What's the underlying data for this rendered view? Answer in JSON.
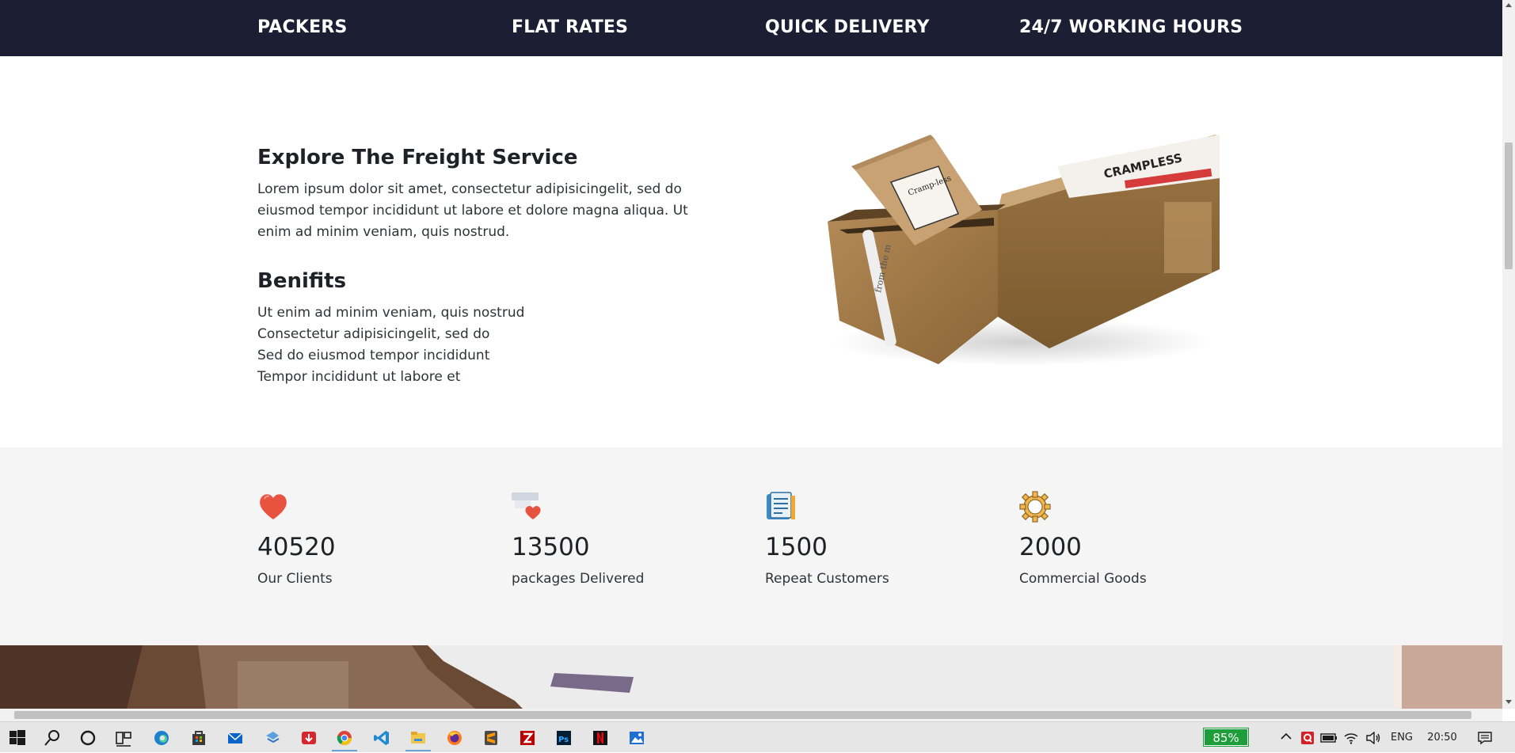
{
  "features": {
    "items": [
      "PACKERS",
      "FLAT RATES",
      "QUICK DELIVERY",
      "24/7 WORKING HOURS"
    ]
  },
  "explore": {
    "title": "Explore The Freight Service",
    "text": "Lorem ipsum dolor sit amet, consectetur adipisicingelit, sed do eiusmod tempor incididunt ut labore et dolore magna aliqua. Ut enim ad minim veniam, quis nostrud."
  },
  "benefits": {
    "title": "Benifits",
    "items": [
      "Ut enim ad minim veniam, quis nostrud",
      "Consectetur adipisicingelit, sed do",
      "Sed do eiusmod tempor incididunt",
      "Tempor incididunt ut labore et"
    ]
  },
  "product_image": {
    "label_big": "CRAMPLESS",
    "label_bag": "Cramp-less",
    "label_tab": "from the m"
  },
  "stats": [
    {
      "icon": "heart-icon",
      "number": "40520",
      "label": "Our Clients"
    },
    {
      "icon": "package-heart-icon",
      "number": "13500",
      "label": "packages Delivered"
    },
    {
      "icon": "document-list-icon",
      "number": "1500",
      "label": "Repeat Customers"
    },
    {
      "icon": "gear-icon",
      "number": "2000",
      "label": "Commercial Goods"
    }
  ],
  "colors": {
    "navbar": "#1c1f33",
    "stats_bg": "#f5f5f5",
    "heart": "#e8533f",
    "battery": "#1e9e3a"
  },
  "taskbar": {
    "apps": [
      "start-icon",
      "search-icon",
      "cortana-icon",
      "task-view-icon",
      "edge-icon",
      "store-icon",
      "mail-icon",
      "app-icon",
      "download-icon",
      "chrome-icon",
      "vscode-icon",
      "file-explorer-icon",
      "firefox-icon",
      "sublime-icon",
      "filezilla-icon",
      "photoshop-icon",
      "netflix-icon",
      "photos-icon"
    ],
    "battery_badge": "85%",
    "language": "ENG",
    "time": "20:50"
  }
}
